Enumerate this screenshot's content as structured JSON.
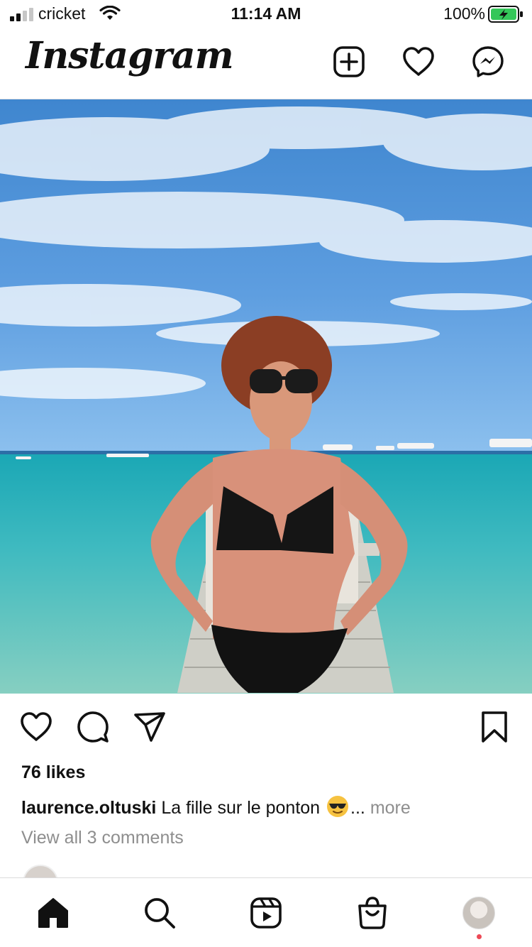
{
  "status_bar": {
    "carrier": "cricket",
    "time": "11:14 AM",
    "battery": "100%",
    "battery_color": "#34c759"
  },
  "header": {
    "logo": "Instagram",
    "icons": [
      "new-post-icon",
      "heart-icon",
      "messenger-icon"
    ]
  },
  "post": {
    "photo_description_icon": "beach-pier-photo",
    "actions": [
      "heart-icon",
      "comment-icon",
      "share-icon",
      "bookmark-icon"
    ],
    "likes": "76 likes",
    "username": "laurence.oltuski",
    "caption": "La fille sur le ponton",
    "caption_emoji": "sunglasses-emoji",
    "ellipsis": "...",
    "more": "more",
    "view_comments": "View all 3 comments"
  },
  "tab_bar": {
    "tabs": [
      "home-icon",
      "search-icon",
      "reels-icon",
      "shop-icon",
      "profile-avatar"
    ],
    "notification_color": "#ed4956"
  }
}
